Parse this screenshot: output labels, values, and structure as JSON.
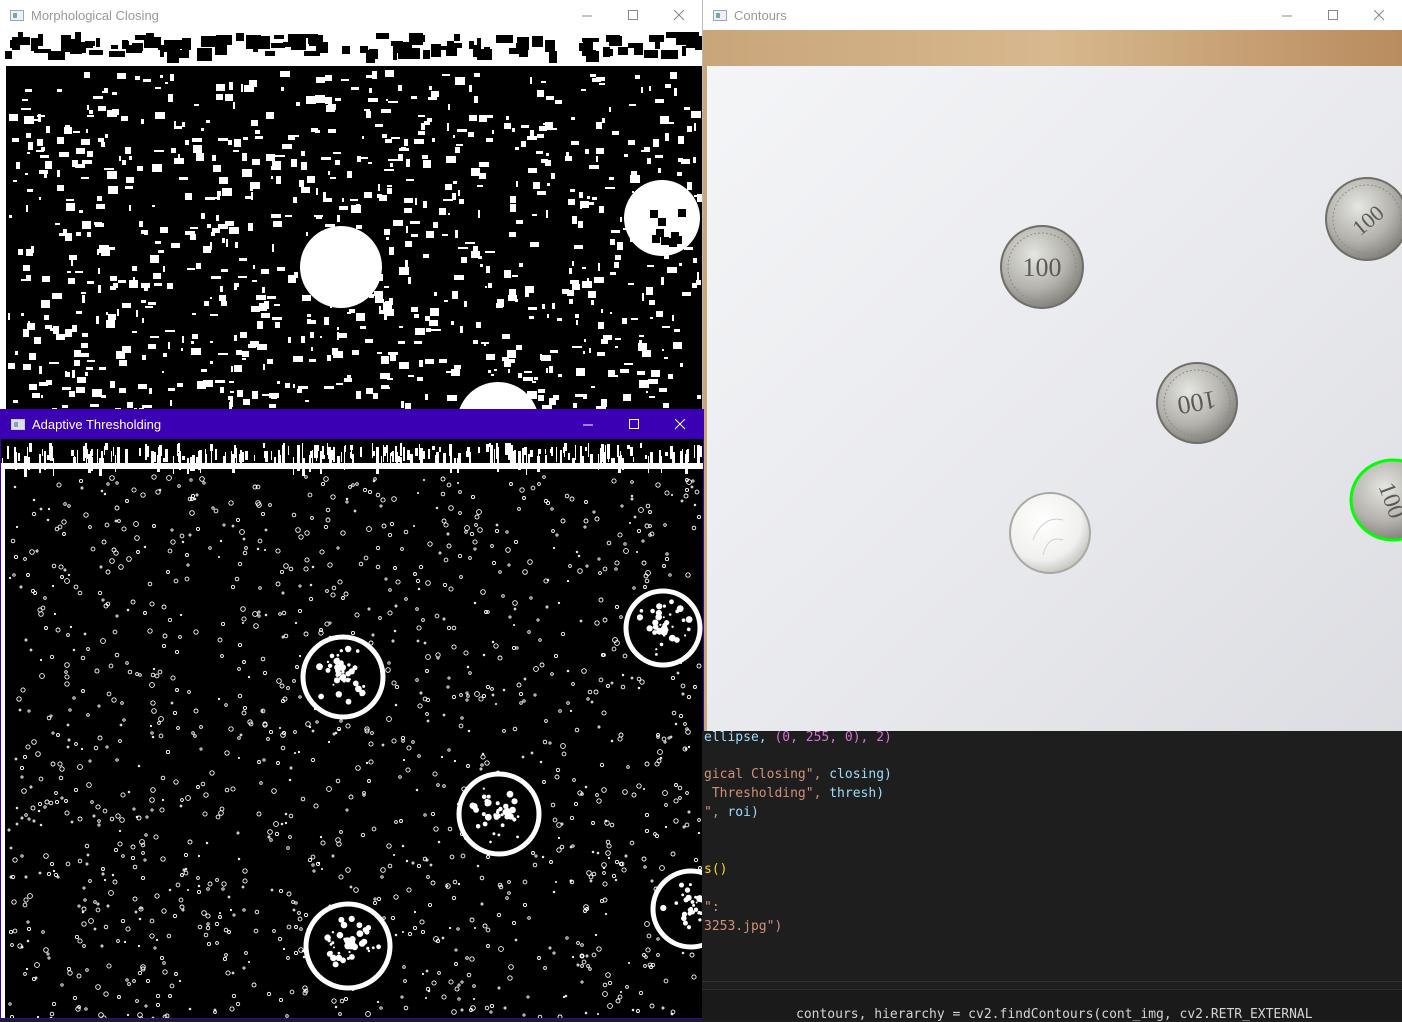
{
  "windows": {
    "closing": {
      "title": "Morphological Closing",
      "state": "inactive"
    },
    "contours": {
      "title": "Contours",
      "state": "inactive"
    },
    "thresh": {
      "title": "Adaptive Thresholding",
      "state": "active"
    }
  },
  "window_controls": {
    "minimize": "minimize-icon",
    "maximize": "maximize-icon",
    "close": "close-icon"
  },
  "coins": {
    "contours": [
      {
        "label": "100",
        "style": "silver-top"
      },
      {
        "label": "100",
        "style": "silver-tilt"
      },
      {
        "label": "",
        "style": "shiny"
      },
      {
        "label": "100",
        "style": "edge-top"
      },
      {
        "label": "100",
        "style": "edge-highlighted"
      }
    ]
  },
  "code": {
    "lines": [
      [
        "ellipse, ",
        "(0, 255, 0), 2)"
      ],
      [
        "gical Closing\", ",
        "closing)"
      ],
      [
        " Thresholding\", ",
        "thresh)"
      ],
      [
        "\", ",
        "roi)"
      ],
      [
        "s()"
      ],
      [
        "\":"
      ],
      [
        "3253.jpg\")"
      ]
    ],
    "bottom": "contours, hierarchy = cv2.findContours(cont_img, cv2.RETR_EXTERNAL"
  },
  "colors": {
    "active_title": "#3b00b3",
    "contour_green": "#00ff00",
    "editor_bg": "#1e1e1e"
  }
}
